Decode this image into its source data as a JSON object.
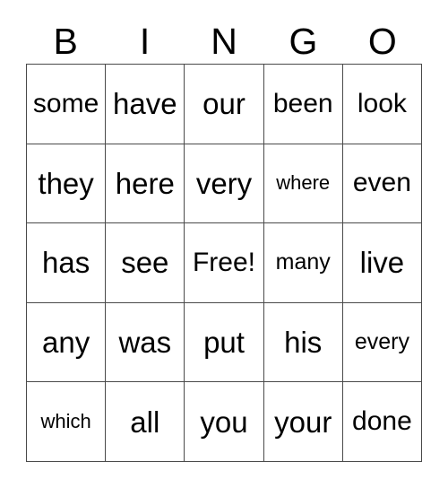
{
  "card": {
    "type": "bingo-card",
    "header_letters": [
      "B",
      "I",
      "N",
      "G",
      "O"
    ],
    "colors": {
      "background": "#ffffff",
      "text": "#000000",
      "grid_line": "#4a4a4a"
    },
    "rows": [
      [
        {
          "text": "some",
          "size": "md"
        },
        {
          "text": "have",
          "size": "lg"
        },
        {
          "text": "our",
          "size": "lg"
        },
        {
          "text": "been",
          "size": "md"
        },
        {
          "text": "look",
          "size": "md"
        }
      ],
      [
        {
          "text": "they",
          "size": "lg"
        },
        {
          "text": "here",
          "size": "lg"
        },
        {
          "text": "very",
          "size": "lg"
        },
        {
          "text": "where",
          "size": "xs"
        },
        {
          "text": "even",
          "size": "md"
        }
      ],
      [
        {
          "text": "has",
          "size": "lg"
        },
        {
          "text": "see",
          "size": "lg"
        },
        {
          "text": "Free!",
          "size": "md"
        },
        {
          "text": "many",
          "size": "sm"
        },
        {
          "text": "live",
          "size": "lg"
        }
      ],
      [
        {
          "text": "any",
          "size": "lg"
        },
        {
          "text": "was",
          "size": "lg"
        },
        {
          "text": "put",
          "size": "lg"
        },
        {
          "text": "his",
          "size": "lg"
        },
        {
          "text": "every",
          "size": "sm"
        }
      ],
      [
        {
          "text": "which",
          "size": "xs"
        },
        {
          "text": "all",
          "size": "lg"
        },
        {
          "text": "you",
          "size": "lg"
        },
        {
          "text": "your",
          "size": "lg"
        },
        {
          "text": "done",
          "size": "md"
        }
      ]
    ]
  }
}
